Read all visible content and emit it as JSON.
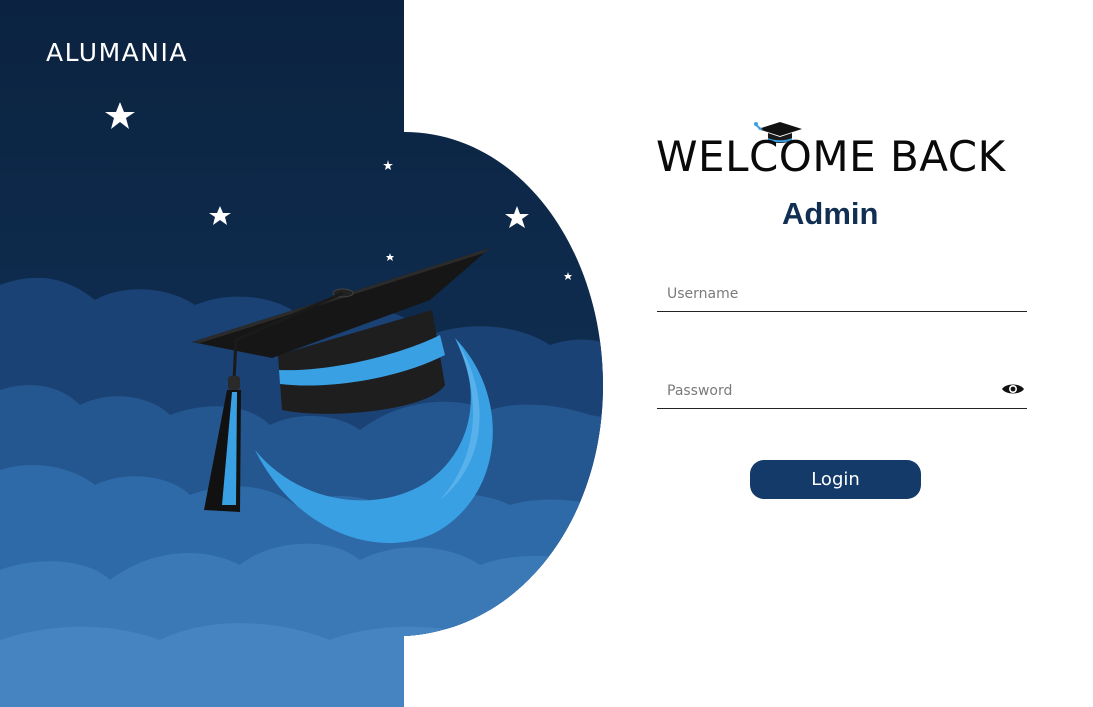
{
  "brand": {
    "name": "ALUMANIA"
  },
  "header": {
    "title": "WELCOME BACK",
    "role": "Admin"
  },
  "form": {
    "username_placeholder": "Username",
    "password_placeholder": "Password",
    "login_label": "Login"
  },
  "icons": {
    "visibility_toggle": "eye-icon",
    "title_decoration": "graduation-cap-icon"
  },
  "colors": {
    "accent": "#143a6a",
    "role_text": "#102f52",
    "night_sky": "#0d2a48",
    "cap_band": "#3aa0e4"
  }
}
